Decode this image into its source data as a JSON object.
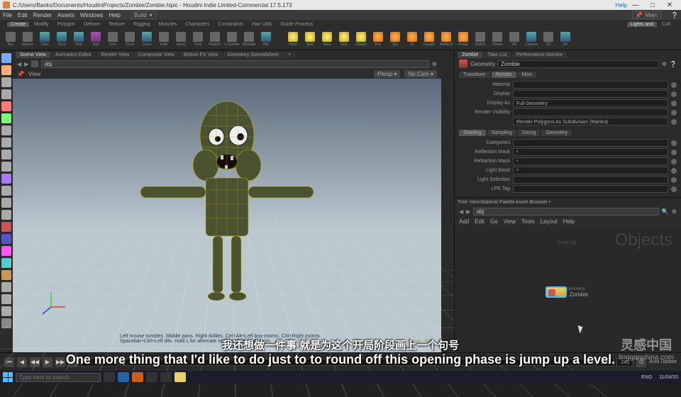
{
  "titlebar": {
    "path": "C:/Users/Banks/Documents/HoudiniProjects/Zombie/Zombie.hipic - Houdini Indie Limited-Commercial  17.5.173",
    "help_link": "Help"
  },
  "menubar": {
    "items": [
      "File",
      "Edit",
      "Render",
      "Assets",
      "Windows",
      "Help"
    ],
    "desktop_label": "Build",
    "pin_label": "Main"
  },
  "shelf": {
    "left_tabs": [
      "Create",
      "Modify",
      "Polygon",
      "Deform",
      "Texture",
      "Rigging",
      "Muscles",
      "Characters",
      "Constraints",
      "Hair Utils",
      "Guide Process"
    ],
    "right_tabs": [
      "Lights and",
      "Coll"
    ],
    "left_tools": [
      {
        "label": "Box",
        "cls": "grey"
      },
      {
        "label": "Sphere",
        "cls": "grey"
      },
      {
        "label": "Tube",
        "cls": "blue"
      },
      {
        "label": "Torus",
        "cls": "blue"
      },
      {
        "label": "Grid",
        "cls": "blue"
      },
      {
        "label": "Null",
        "cls": "mag"
      },
      {
        "label": "Line",
        "cls": "grey"
      },
      {
        "label": "Circle",
        "cls": "grey"
      },
      {
        "label": "Curve",
        "cls": "blue"
      },
      {
        "label": "Path",
        "cls": "grey"
      },
      {
        "label": "Spray",
        "cls": "grey"
      },
      {
        "label": "Font",
        "cls": "grey"
      },
      {
        "label": "Platonic",
        "cls": "grey"
      },
      {
        "label": "L-System",
        "cls": "grey"
      },
      {
        "label": "Metaball",
        "cls": "grey"
      },
      {
        "label": "File",
        "cls": "blue"
      }
    ],
    "right_tools": [
      {
        "label": "Point",
        "cls": "yellow"
      },
      {
        "label": "Spot",
        "cls": "yellow"
      },
      {
        "label": "Area",
        "cls": "yellow"
      },
      {
        "label": "Geo",
        "cls": "yellow"
      },
      {
        "label": "Distant",
        "cls": "yellow"
      },
      {
        "label": "Env",
        "cls": "orange"
      },
      {
        "label": "Sky",
        "cls": "orange"
      },
      {
        "label": "GI",
        "cls": "orange"
      },
      {
        "label": "Caustic",
        "cls": "orange"
      },
      {
        "label": "Ambient",
        "cls": "orange"
      },
      {
        "label": "Portal",
        "cls": "orange"
      },
      {
        "label": "Switch",
        "cls": "grey"
      },
      {
        "label": "Stereo",
        "cls": "grey"
      },
      {
        "label": "VR",
        "cls": "grey"
      },
      {
        "label": "Camera",
        "cls": "blue"
      },
      {
        "label": "2D",
        "cls": "grey"
      },
      {
        "label": "UV",
        "cls": "blue"
      }
    ]
  },
  "pane_tabs_left": [
    "Scene View",
    "Animation Editor",
    "Render View",
    "Composite View",
    "Motion FX View",
    "Geometry Spreadsheet"
  ],
  "pane_tabs_right_top": [
    "Zombie",
    "Take List",
    "Performance Monitor"
  ],
  "viewport": {
    "path_label": "obj",
    "view_label": "View",
    "persp_btn": "Persp",
    "nocam_btn": "No Cam",
    "hint": "Left mouse tumbles.  Middle pans.  Right dollies.  Ctrl+Alt+Left box-zooms.  Ctrl+Right zooms.  Spacebar+Ctrl+Left tilts.  Hold L for alternate tumble, dolly, and zoom.",
    "corner": "Persp - Main"
  },
  "params": {
    "node_icon": "Geometry",
    "node_name": "Zombie",
    "tab_row1": [
      "Transform",
      "Render",
      "Misc"
    ],
    "rows1": [
      {
        "label": "Material",
        "value": ""
      },
      {
        "label": "Display",
        "value": ""
      },
      {
        "label": "Display As",
        "value": "Full Geometry"
      },
      {
        "label": "Render Visibility",
        "value": ""
      },
      {
        "label": "",
        "value": "Render Polygons As Subdivision (Mantra)"
      }
    ],
    "tab_row2": [
      "Shading",
      "Sampling",
      "Dicing",
      "Geometry"
    ],
    "rows2": [
      {
        "label": "Categories",
        "value": ""
      },
      {
        "label": "Reflection Mask",
        "value": "*"
      },
      {
        "label": "Refraction Mask",
        "value": "*"
      },
      {
        "label": "Light Mask",
        "value": "*"
      },
      {
        "label": "Light Selection",
        "value": ""
      },
      {
        "label": "LPE Tag",
        "value": ""
      }
    ]
  },
  "network": {
    "tabs": [
      "Tree View",
      "Material Palette",
      "Asset Browser"
    ],
    "path": "obj",
    "menus": [
      "Add",
      "Edit",
      "Go",
      "View",
      "Tools",
      "Layout",
      "Help"
    ],
    "context_label": "Objects",
    "jump_label": "Jump Up",
    "node": {
      "type": "Geometry",
      "name": "Zombie"
    }
  },
  "timeline": {
    "start": "1",
    "current": "1",
    "end": "240",
    "end2": "240",
    "auto_label": "Auto Update"
  },
  "subtitles": {
    "cn": "我还想做一件事 就是为这个开局阶段画上一个句号",
    "en": "One more thing that I'd like to do just to to round off this opening phase is jump up a level."
  },
  "watermark": {
    "cn": "灵感中国",
    "url": "lingganchina.com"
  },
  "taskbar": {
    "search_placeholder": "Type here to search",
    "time": "11/04/20",
    "lang": "ENG"
  },
  "side_tool_colors": [
    "#7af",
    "#fa7",
    "#aaa",
    "#aaa",
    "#f77",
    "#7f7",
    "#aaa",
    "#aaa",
    "#aaa",
    "#aaa",
    "#a7f",
    "#aaa",
    "#aaa",
    "#aaa",
    "#c55",
    "#55c",
    "#f5f",
    "#5cc",
    "#c95",
    "#aaa",
    "#aaa",
    "#aaa",
    "#888"
  ],
  "rcol_colors": [
    "#888",
    "#888",
    "#888",
    "#fa5",
    "#888",
    "#888",
    "#888",
    "#888",
    "#888",
    "#888",
    "#5af",
    "#888",
    "#888",
    "#888",
    "#888"
  ],
  "chart_data": {
    "type": "table",
    "note": "no chart present"
  }
}
